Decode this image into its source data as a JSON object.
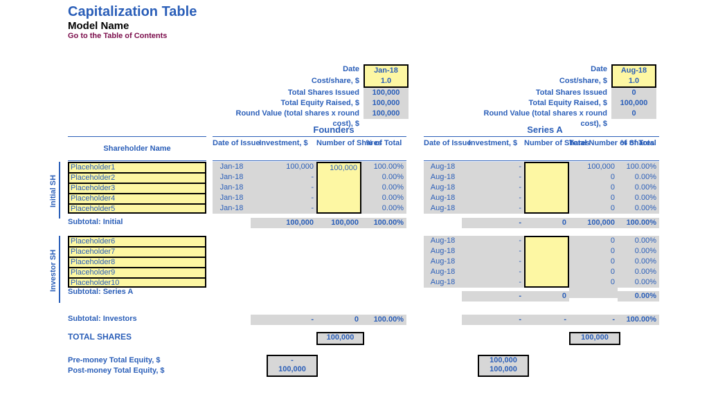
{
  "header": {
    "title": "Capitalization Table",
    "subtitle": "Model Name",
    "toc_link": "Go to the Table of Contents"
  },
  "labels": {
    "date": "Date",
    "cost_share": "Cost/share, $",
    "tsi": "Total Shares Issued",
    "ter": "Total Equity Raised, $",
    "rv": "Round Value (total shares x round cost), $",
    "shareholder": "Shareholder Name",
    "date_issue": "Date of Issue",
    "investment": "Investment, $",
    "num_shares": "Number of Shares",
    "pct_total": "% of Total",
    "total_num_shares": "Total Number of Shares",
    "sub_initial": "Subtotal: Initial",
    "sub_seriesA": "Subtotal: Series A",
    "sub_investors": "Subtotal: Investors",
    "total_shares": "TOTAL SHARES",
    "pre_money": "Pre-money Total Equity, $",
    "post_money": "Post-money Total Equity, $",
    "initial_sh": "Initial SH",
    "investor_sh": "Investor SH"
  },
  "rounds": {
    "founders": {
      "title": "Founders",
      "date": "Jan-18",
      "cost": "1.0",
      "tsi": "100,000",
      "ter": "100,000",
      "rv": "100,000",
      "pre": "-",
      "post": "100,000",
      "total": "100,000"
    },
    "seriesA": {
      "title": "Series A",
      "date": "Aug-18",
      "cost": "1.0",
      "tsi": "0",
      "ter": "100,000",
      "rv": "0",
      "pre": "100,000",
      "post": "100,000",
      "total": "100,000"
    }
  },
  "initial": [
    {
      "name": "Placeholder1",
      "f": {
        "date": "Jan-18",
        "inv": "100,000",
        "sh": "100,000",
        "pct": "100.00%"
      },
      "a": {
        "date": "Aug-18",
        "inv": "-",
        "sh": "",
        "tns": "100,000",
        "pct": "100.00%"
      }
    },
    {
      "name": "Placeholder2",
      "f": {
        "date": "Jan-18",
        "inv": "-",
        "sh": "",
        "pct": "0.00%"
      },
      "a": {
        "date": "Aug-18",
        "inv": "-",
        "sh": "",
        "tns": "0",
        "pct": "0.00%"
      }
    },
    {
      "name": "Placeholder3",
      "f": {
        "date": "Jan-18",
        "inv": "-",
        "sh": "",
        "pct": "0.00%"
      },
      "a": {
        "date": "Aug-18",
        "inv": "-",
        "sh": "",
        "tns": "0",
        "pct": "0.00%"
      }
    },
    {
      "name": "Placeholder4",
      "f": {
        "date": "Jan-18",
        "inv": "-",
        "sh": "",
        "pct": "0.00%"
      },
      "a": {
        "date": "Aug-18",
        "inv": "-",
        "sh": "",
        "tns": "0",
        "pct": "0.00%"
      }
    },
    {
      "name": "Placeholder5",
      "f": {
        "date": "Jan-18",
        "inv": "-",
        "sh": "",
        "pct": "0.00%"
      },
      "a": {
        "date": "Aug-18",
        "inv": "-",
        "sh": "",
        "tns": "0",
        "pct": "0.00%"
      }
    }
  ],
  "sub_initial": {
    "f": {
      "inv": "100,000",
      "sh": "100,000",
      "pct": "100.00%"
    },
    "a": {
      "inv": "-",
      "sh": "0",
      "tns": "100,000",
      "pct": "100.00%"
    }
  },
  "investor": [
    {
      "name": "Placeholder6",
      "a": {
        "date": "Aug-18",
        "inv": "-",
        "sh": "",
        "tns": "0",
        "pct": "0.00%"
      }
    },
    {
      "name": "Placeholder7",
      "a": {
        "date": "Aug-18",
        "inv": "-",
        "sh": "",
        "tns": "0",
        "pct": "0.00%"
      }
    },
    {
      "name": "Placeholder8",
      "a": {
        "date": "Aug-18",
        "inv": "-",
        "sh": "",
        "tns": "0",
        "pct": "0.00%"
      }
    },
    {
      "name": "Placeholder9",
      "a": {
        "date": "Aug-18",
        "inv": "-",
        "sh": "",
        "tns": "0",
        "pct": "0.00%"
      }
    },
    {
      "name": "Placeholder10",
      "a": {
        "date": "Aug-18",
        "inv": "-",
        "sh": "",
        "tns": "0",
        "pct": "0.00%"
      }
    }
  ],
  "sub_seriesA": {
    "a": {
      "inv": "-",
      "sh": "0",
      "tns": "",
      "pct": "0.00%"
    }
  },
  "sub_investors": {
    "f": {
      "inv": "-",
      "sh": "0",
      "pct": "100.00%"
    },
    "a": {
      "inv": "-",
      "sh": "-",
      "tns": "-",
      "pct": "100.00%"
    }
  }
}
